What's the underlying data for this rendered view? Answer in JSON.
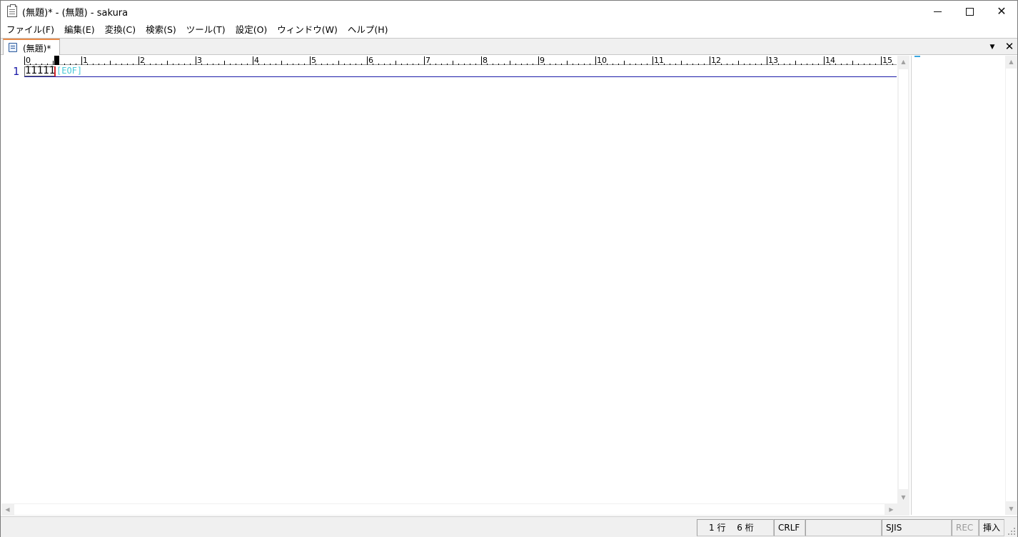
{
  "window": {
    "title": "(無題)* - (無題) - sakura",
    "minimize_label": "",
    "maximize_label": "",
    "close_label": "✕"
  },
  "menu": {
    "items": [
      {
        "label": "ファイル(F)"
      },
      {
        "label": "編集(E)"
      },
      {
        "label": "変換(C)"
      },
      {
        "label": "検索(S)"
      },
      {
        "label": "ツール(T)"
      },
      {
        "label": "設定(O)"
      },
      {
        "label": "ウィンドウ(W)"
      },
      {
        "label": "ヘルプ(H)"
      }
    ]
  },
  "tabs": {
    "items": [
      {
        "label": "(無題)*"
      }
    ],
    "dropdown_icon": "▼",
    "close_icon": "✕"
  },
  "ruler": {
    "labels": [
      "0",
      "1",
      "2",
      "3",
      "4",
      "5",
      "6",
      "7",
      "8",
      "9",
      "10",
      "11",
      "12",
      "13",
      "14",
      "15"
    ]
  },
  "editor": {
    "line_number": "1",
    "line_text": "11111",
    "eof_marker": "[EOF]"
  },
  "status": {
    "position": "1 行　 6 桁",
    "line_ending": "CRLF",
    "blank": "",
    "encoding": "SJIS",
    "rec": "REC",
    "insert_mode": "挿入"
  },
  "colors": {
    "line_number": "#1a1aa8",
    "caret": "#d0242a",
    "eof": "#48c8d8",
    "tab_accent": "#e88a47"
  }
}
